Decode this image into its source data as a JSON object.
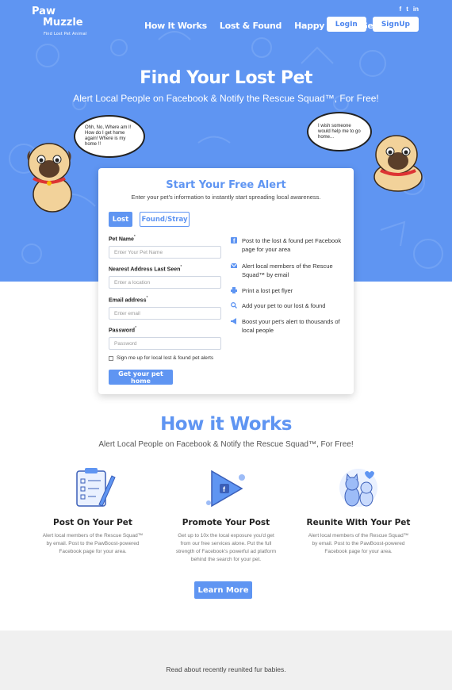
{
  "brand": {
    "line1": "Paw",
    "line2": "Muzzle",
    "tagline": "Find Lost Pet Animal"
  },
  "nav": [
    "How It Works",
    "Lost & Found",
    "Happy Tails",
    "Get Alert"
  ],
  "socials": [
    "f",
    "t",
    "in"
  ],
  "auth": {
    "login": "LogIn",
    "signup": "SignUp"
  },
  "hero": {
    "title": "Find Your Lost Pet",
    "subtitle": "Alert Local People on Facebook & Notify the Rescue Squad™, For Free!",
    "bubble_left": "Ohh, No, Where am I! How do I get home again! Where is my home !!",
    "bubble_right": "I wish someone would help me to go home..."
  },
  "form": {
    "title": "Start Your Free Alert",
    "intro": "Enter your pet's information to instantly start spreading local awareness.",
    "toggle": {
      "lost": "Lost",
      "found": "Found/Stray"
    },
    "fields": [
      {
        "label": "Pet Name",
        "placeholder": "Enter Your Pet Name"
      },
      {
        "label": "Nearest Address Last Seen",
        "placeholder": "Enter a location"
      },
      {
        "label": "Email address",
        "placeholder": "Enter email"
      },
      {
        "label": "Password",
        "placeholder": "Password"
      }
    ],
    "required_mark": "*",
    "checkbox": "Sign me up for local lost & found pet alerts",
    "submit": "Get your pet home",
    "features": [
      {
        "icon": "facebook-icon",
        "text": "Post to the lost & found pet Facebook page for your area"
      },
      {
        "icon": "email-icon",
        "text": "Alert local members of the Rescue Squad™ by email"
      },
      {
        "icon": "printer-icon",
        "text": "Print a lost pet flyer"
      },
      {
        "icon": "search-icon",
        "text": "Add your pet to our lost & found"
      },
      {
        "icon": "megaphone-icon",
        "text": "Boost your pet's alert to thousands of local people"
      }
    ]
  },
  "how": {
    "title": "How it Works",
    "subtitle": "Alert Local People on Facebook & Notify the Rescue Squad™, For Free!",
    "steps": [
      {
        "title": "Post On Your Pet",
        "text": "Alert local members of the Rescue Squad™ by email. Post to the PawBoost-powered Facebook page for your area."
      },
      {
        "title": "Promote Your Post",
        "text": "Get up to 10x the local exposure you'd get from our free services alone. Put the full strength of Facebook's powerful ad platform behind the search for your pet."
      },
      {
        "title": "Reunite With Your Pet",
        "text": "Alert local members of the Rescue Squad™ by email. Post to the PawBoost-powered Facebook page for your area."
      }
    ],
    "button": "Learn More"
  },
  "bottom": {
    "read": "Read about recently reunited fur babies."
  },
  "colors": {
    "accent": "#5f95f2",
    "hero_bg": "#5f95f2",
    "footer_bg": "#f0f0f0"
  }
}
